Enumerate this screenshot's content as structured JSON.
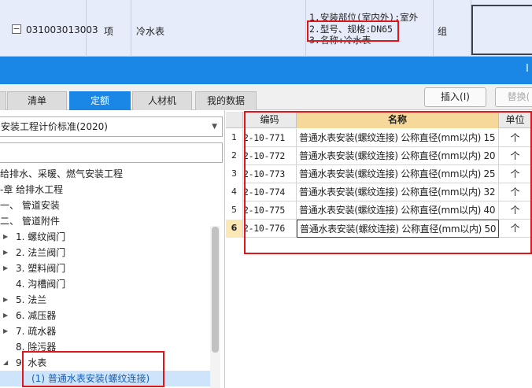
{
  "bill_row": {
    "code": "031003013003",
    "type": "项",
    "name": "冷水表",
    "description_lines": [
      "1.安装部位(室内外):室外",
      "2.型号、规格:DN65",
      "3.名称:冷水表"
    ],
    "unit": "组",
    "collapse_symbol": "−"
  },
  "title_bar": {
    "right_mark": "Ⅰ"
  },
  "tabs": [
    {
      "label": ""
    },
    {
      "label": "清单"
    },
    {
      "label": "定额"
    },
    {
      "label": "人材机"
    },
    {
      "label": "我的数据"
    }
  ],
  "toolbar": {
    "insert_label": "插入(I)",
    "replace_label": "替换("
  },
  "left_panel": {
    "standard_selected": "安装工程计价标准(2020)",
    "search_value": "",
    "tree": [
      {
        "label": "给排水、采暖、燃气安装工程",
        "toggle": ""
      },
      {
        "label": "-章 给排水工程",
        "toggle": ""
      },
      {
        "label": "一、 管道安装",
        "toggle": ""
      },
      {
        "label": "二、 管道附件",
        "toggle": ""
      },
      {
        "label": "1. 螺纹阀门",
        "toggle": "▶"
      },
      {
        "label": "2. 法兰阀门",
        "toggle": "▶"
      },
      {
        "label": "3. 塑料阀门",
        "toggle": "▶"
      },
      {
        "label": "4. 沟槽阀门",
        "toggle": ""
      },
      {
        "label": "5. 法兰",
        "toggle": "▶"
      },
      {
        "label": "6. 减压器",
        "toggle": "▶"
      },
      {
        "label": "7. 疏水器",
        "toggle": "▶"
      },
      {
        "label": "8. 除污器",
        "toggle": ""
      },
      {
        "label": "9. 水表",
        "toggle": "◢"
      },
      {
        "label": "(1) 普通水表安装(螺纹连接)",
        "toggle": ""
      }
    ]
  },
  "quota_table": {
    "headers": {
      "code": "编码",
      "name": "名称",
      "unit": "单位"
    },
    "rows": [
      {
        "no": "1",
        "code": "2-10-771",
        "name": "普通水表安装(螺纹连接) 公称直径(mm以内) 15",
        "unit": "个"
      },
      {
        "no": "2",
        "code": "2-10-772",
        "name": "普通水表安装(螺纹连接) 公称直径(mm以内) 20",
        "unit": "个"
      },
      {
        "no": "3",
        "code": "2-10-773",
        "name": "普通水表安装(螺纹连接) 公称直径(mm以内) 25",
        "unit": "个"
      },
      {
        "no": "4",
        "code": "2-10-774",
        "name": "普通水表安装(螺纹连接) 公称直径(mm以内) 32",
        "unit": "个"
      },
      {
        "no": "5",
        "code": "2-10-775",
        "name": "普通水表安装(螺纹连接) 公称直径(mm以内) 40",
        "unit": "个"
      },
      {
        "no": "6",
        "code": "2-10-776",
        "name": "普通水表安装(螺纹连接) 公称直径(mm以内) 50",
        "unit": "个"
      }
    ]
  },
  "colors": {
    "accent_blue": "#1a86e5",
    "highlight_red": "#e0161b",
    "header_gold": "#f6d99a",
    "selected_row": "#cde4fb"
  }
}
